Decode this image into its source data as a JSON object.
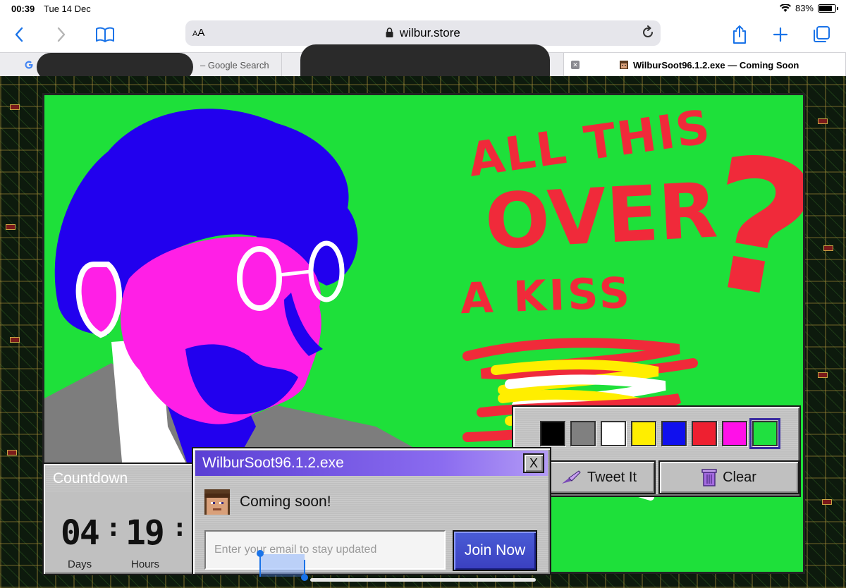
{
  "status_bar": {
    "time": "00:39",
    "date": "Tue 14 Dec",
    "battery_percent": "83%",
    "battery_level": 0.83
  },
  "browser": {
    "aa_label_small": "A",
    "aa_label_large": "A",
    "url": "wilbur.store",
    "tabs": [
      {
        "label": "– Google Search",
        "active": false
      },
      {
        "label": "",
        "active": false
      },
      {
        "label": "WilburSoot96.1.2.exe — Coming Soon",
        "active": true
      }
    ]
  },
  "artwork": {
    "text_lines": [
      "ALL THIS",
      "OVER",
      "A KISS",
      "?"
    ],
    "colors": {
      "background": "#1ee03a",
      "hair": "#2200ee",
      "skin": "#ff1fe6",
      "lettering": "#f02a3a",
      "suit": "#7d7d7d"
    }
  },
  "palette": {
    "colors": [
      "#000000",
      "#808080",
      "#ffffff",
      "#ffee00",
      "#1010ee",
      "#ee2030",
      "#ff10e8",
      "#20e040"
    ],
    "selected_index": 7,
    "tweet_label": "Tweet It",
    "clear_label": "Clear"
  },
  "countdown": {
    "title": "Countdown",
    "days_value": "04",
    "hours_value": "19",
    "separator": ":",
    "days_label": "Days",
    "hours_label": "Hours"
  },
  "dialog": {
    "title": "WilburSoot96.1.2.exe",
    "close_label": "X",
    "message": "Coming soon!",
    "email_placeholder": "Enter your email to stay updated",
    "join_label": "Join Now"
  }
}
